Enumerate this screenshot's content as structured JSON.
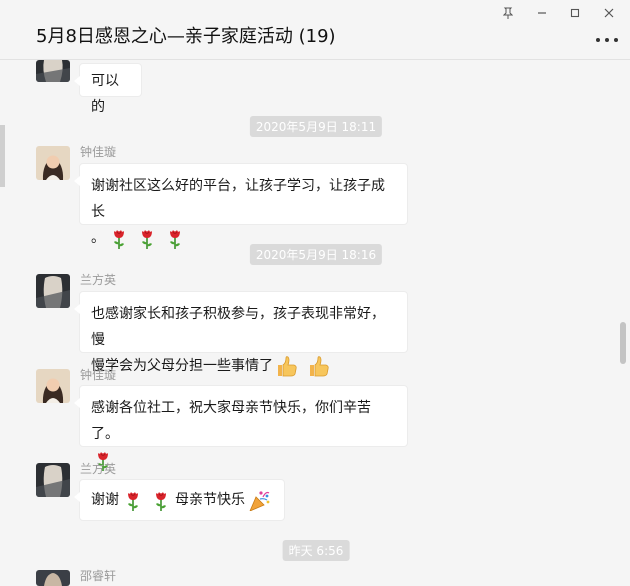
{
  "window": {
    "title": "5月8日感恩之心—亲子家庭活动 (19)",
    "pin_icon": "pin-icon",
    "minimize_icon": "minimize-icon",
    "maximize_icon": "maximize-icon",
    "close_icon": "close-icon",
    "more_icon": "more-icon"
  },
  "messages": [
    {
      "type": "message",
      "sender": "",
      "text": "可以的"
    },
    {
      "type": "time",
      "text": "2020年5月9日 18:11"
    },
    {
      "type": "message",
      "sender": "钟佳璇",
      "line1": "谢谢社区这么好的平台，让孩子学习，让孩子成长",
      "line2": "。",
      "emoji": "rose",
      "emoji_count": 3
    },
    {
      "type": "time",
      "text": "2020年5月9日 18:16"
    },
    {
      "type": "message",
      "sender": "兰方英",
      "line1": "也感谢家长和孩子积极参与，孩子表现非常好，慢",
      "line2": "慢学会为父母分担一些事情了",
      "emoji": "thumbs-up",
      "emoji_count": 2
    },
    {
      "type": "message",
      "sender": "钟佳璇",
      "line1": "感谢各位社工，祝大家母亲节快乐，你们辛苦了。",
      "emoji": "rose",
      "emoji_count": 1
    },
    {
      "type": "message",
      "sender": "兰方英",
      "text_before": "谢谢",
      "text_after": "母亲节快乐",
      "emoji": "rose",
      "emoji_count": 2,
      "trailing_emoji": "party-popper"
    },
    {
      "type": "time",
      "text": "昨天 6:56"
    },
    {
      "type": "message",
      "sender": "邵睿轩",
      "text": ""
    }
  ]
}
